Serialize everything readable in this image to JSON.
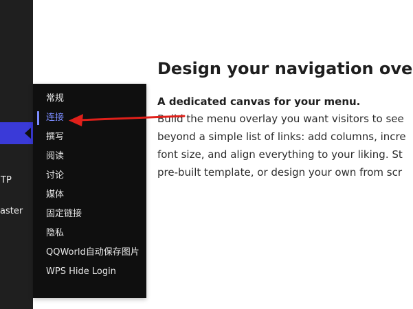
{
  "sidebar": {
    "partial_labels": [
      "TP",
      "aster"
    ]
  },
  "submenu": {
    "items": [
      {
        "label": "常规",
        "current": false
      },
      {
        "label": "连接",
        "current": true
      },
      {
        "label": "撰写",
        "current": false
      },
      {
        "label": "阅读",
        "current": false
      },
      {
        "label": "讨论",
        "current": false
      },
      {
        "label": "媒体",
        "current": false
      },
      {
        "label": "固定链接",
        "current": false
      },
      {
        "label": "隐私",
        "current": false
      },
      {
        "label": "QQWorld自动保存图片",
        "current": false
      },
      {
        "label": "WPS Hide Login",
        "current": false
      }
    ]
  },
  "main": {
    "heading": "Design your navigation overlay",
    "subheading": "A dedicated canvas for your menu.",
    "paragraph_lines": [
      "Build the menu overlay you want visitors to see",
      "beyond a simple list of links: add columns, incre",
      "font size, and align everything to your liking. St",
      "pre-built template, or design your own from scr"
    ]
  },
  "colors": {
    "sidebar_bg": "#1f1f1f",
    "submenu_bg": "#0f0f0f",
    "active_accent": "#3a3ad8",
    "current_item": "#7b8cff",
    "annotation_arrow": "#e0201a"
  }
}
